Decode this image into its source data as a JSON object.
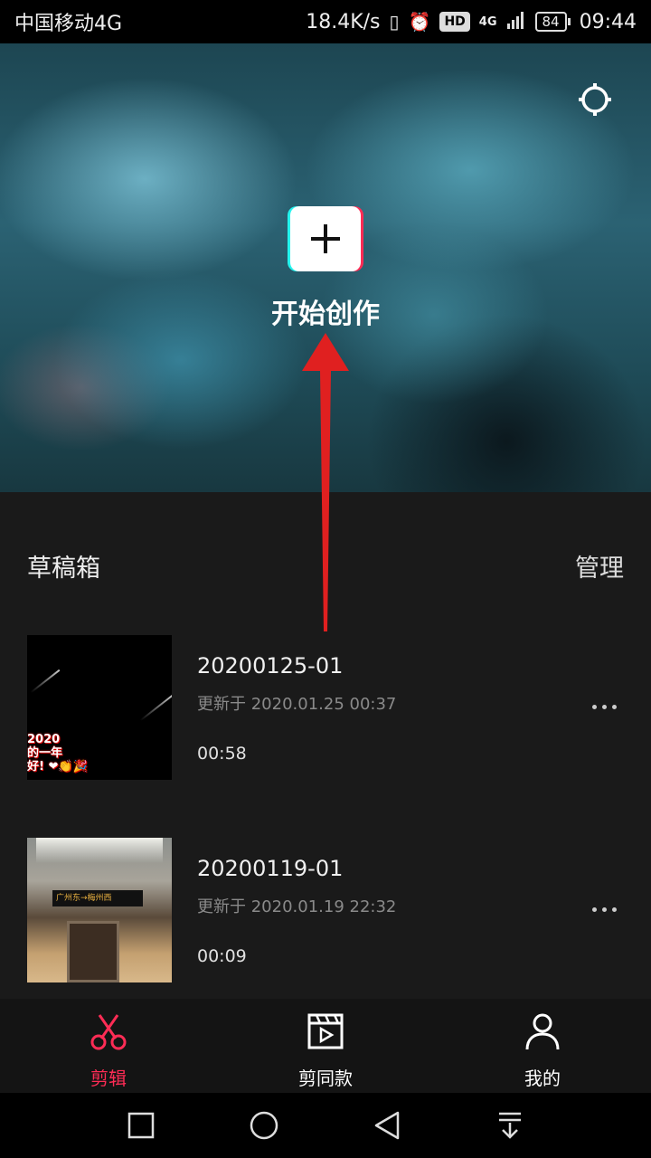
{
  "status_bar": {
    "carrier": "中国移动4G",
    "speed": "18.4K/s",
    "hd_badge": "HD",
    "network": "4G",
    "battery": "84",
    "time": "09:44"
  },
  "hero": {
    "create_label": "开始创作",
    "icons": {
      "settings": "gear-icon",
      "create": "plus-icon"
    }
  },
  "drafts": {
    "title": "草稿箱",
    "manage_label": "管理",
    "items": [
      {
        "name": "20200125-01",
        "updated": "更新于 2020.01.25 00:37",
        "duration": "00:58",
        "thumb_text": "2020\n的一年\n好!"
      },
      {
        "name": "20200119-01",
        "updated": "更新于 2020.01.19 22:32",
        "duration": "00:09",
        "thumb_text": "广州东→梅州西"
      }
    ]
  },
  "tabs": [
    {
      "label": "剪辑",
      "icon": "scissors-icon",
      "active": true
    },
    {
      "label": "剪同款",
      "icon": "template-clapper-icon",
      "active": false
    },
    {
      "label": "我的",
      "icon": "person-icon",
      "active": false
    }
  ],
  "colors": {
    "accent": "#fe2c55",
    "accent_cyan": "#25f4ee",
    "background": "#1a1a1a"
  },
  "nav_bar": {
    "icons": [
      "square-icon",
      "circle-icon",
      "triangle-back-icon",
      "notification-pull-icon"
    ]
  }
}
